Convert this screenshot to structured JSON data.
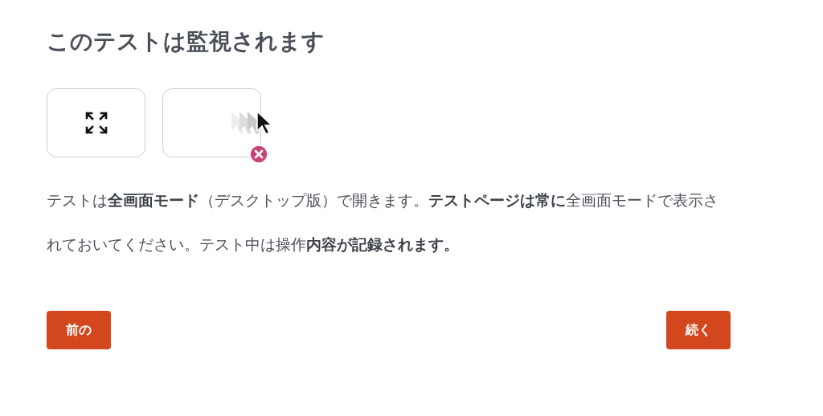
{
  "title": "このテストは監視されます",
  "description": "テストは**全画面モード**（デスクトップ版）で開きます。**テストページは常に**全画面モードで表示されておいてください。テスト中は操作**内容が記録されます。**",
  "buttons": [
    {
      "label": "前の"
    },
    {
      "label": "続く"
    }
  ]
}
